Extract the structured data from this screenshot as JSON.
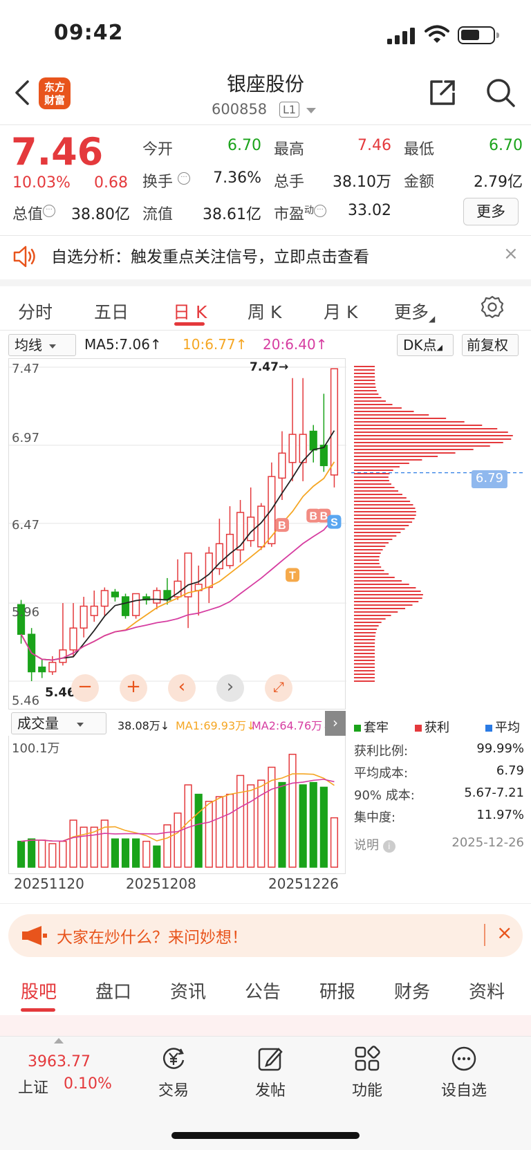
{
  "status_bar": {
    "time": "09:42"
  },
  "header": {
    "logo_text_1": "东方",
    "logo_text_2": "财富",
    "name": "银座股份",
    "code": "600858",
    "level": "L1"
  },
  "quote": {
    "price": "7.46",
    "change_pct": "10.03%",
    "change": "0.68",
    "fields": [
      {
        "label": "今开",
        "value": "6.70",
        "color": "#1aa31a"
      },
      {
        "label": "最高",
        "value": "7.46",
        "color": "#e4393c"
      },
      {
        "label": "最低",
        "value": "6.70",
        "color": "#1aa31a"
      },
      {
        "label": "换手",
        "value": "7.36%",
        "color": "#222222"
      },
      {
        "label": "总手",
        "value": "38.10万",
        "color": "#222222"
      },
      {
        "label": "金额",
        "value": "2.79亿",
        "color": "#222222"
      },
      {
        "label": "总值",
        "value": "38.80亿",
        "color": "#222222"
      },
      {
        "label": "流值",
        "value": "38.61亿",
        "color": "#222222"
      },
      {
        "label": "市盈",
        "label_sup": "动",
        "value": "33.02",
        "color": "#222222"
      }
    ],
    "more_label": "更多"
  },
  "analysis_bar": {
    "text": "自选分析：触发重点关注信号，立即点击查看",
    "close": "×"
  },
  "chart_tabs": {
    "items": [
      "分时",
      "五日",
      "日 K",
      "周 K",
      "月 K",
      "更多"
    ],
    "active_index": 2
  },
  "ma_bar": {
    "select": "均线",
    "ma5": "MA5:7.06↑",
    "ma10": "10:6.77↑",
    "ma20": "20:6.40↑",
    "dk": "DK点",
    "adjust": "前复权",
    "colors": {
      "ma5": "#222222",
      "ma10": "#f5a623",
      "ma20": "#d63ca0"
    }
  },
  "kline": {
    "price_labels": [
      "7.47",
      "6.97",
      "6.47",
      "5.96",
      "5.46"
    ],
    "high_annot": "7.47→",
    "low_annot": "5.46",
    "avg_cost_label": "6.79",
    "signals": {
      "buy": "B",
      "sell": "S",
      "t": "T"
    }
  },
  "chart_data": {
    "type": "candlestick",
    "ylim": [
      5.46,
      7.47
    ],
    "candles": [
      {
        "o": 5.95,
        "c": 5.76,
        "h": 5.98,
        "l": 5.7
      },
      {
        "o": 5.76,
        "c": 5.52,
        "h": 5.8,
        "l": 5.46
      },
      {
        "o": 5.55,
        "c": 5.52,
        "h": 5.6,
        "l": 5.48
      },
      {
        "o": 5.52,
        "c": 5.58,
        "h": 5.62,
        "l": 5.5
      },
      {
        "o": 5.58,
        "c": 5.66,
        "h": 5.96,
        "l": 5.56
      },
      {
        "o": 5.66,
        "c": 5.8,
        "h": 5.96,
        "l": 5.62
      },
      {
        "o": 5.8,
        "c": 5.94,
        "h": 6.0,
        "l": 5.74
      },
      {
        "o": 5.88,
        "c": 5.94,
        "h": 6.04,
        "l": 5.84
      },
      {
        "o": 5.94,
        "c": 6.04,
        "h": 6.06,
        "l": 5.88
      },
      {
        "o": 6.03,
        "c": 6.0,
        "h": 6.05,
        "l": 5.97
      },
      {
        "o": 6.0,
        "c": 5.88,
        "h": 6.02,
        "l": 5.86
      },
      {
        "o": 5.88,
        "c": 6.02,
        "h": 6.02,
        "l": 5.86
      },
      {
        "o": 6.0,
        "c": 5.98,
        "h": 6.02,
        "l": 5.95
      },
      {
        "o": 5.96,
        "c": 6.04,
        "h": 6.06,
        "l": 5.92
      },
      {
        "o": 6.04,
        "c": 5.98,
        "h": 6.12,
        "l": 5.95
      },
      {
        "o": 6.0,
        "c": 6.1,
        "h": 6.24,
        "l": 5.98
      },
      {
        "o": 6.0,
        "c": 6.28,
        "h": 6.28,
        "l": 5.8
      },
      {
        "o": 6.04,
        "c": 6.08,
        "h": 6.2,
        "l": 5.88
      },
      {
        "o": 6.06,
        "c": 6.28,
        "h": 6.32,
        "l": 5.96
      },
      {
        "o": 6.18,
        "c": 6.34,
        "h": 6.5,
        "l": 6.14
      },
      {
        "o": 6.2,
        "c": 6.4,
        "h": 6.58,
        "l": 6.18
      },
      {
        "o": 6.3,
        "c": 6.54,
        "h": 6.62,
        "l": 6.22
      },
      {
        "o": 6.36,
        "c": 6.51,
        "h": 6.7,
        "l": 6.32
      },
      {
        "o": 6.32,
        "c": 6.58,
        "h": 6.6,
        "l": 6.3
      },
      {
        "o": 6.34,
        "c": 6.77,
        "h": 6.86,
        "l": 6.32
      },
      {
        "o": 6.76,
        "c": 6.92,
        "h": 7.06,
        "l": 6.62
      },
      {
        "o": 6.86,
        "c": 7.04,
        "h": 7.4,
        "l": 6.74
      },
      {
        "o": 6.86,
        "c": 7.04,
        "h": 7.4,
        "l": 6.74
      },
      {
        "o": 7.06,
        "c": 6.94,
        "h": 7.1,
        "l": 6.86
      },
      {
        "o": 6.97,
        "c": 6.84,
        "h": 7.3,
        "l": 6.8
      },
      {
        "o": 6.78,
        "c": 7.46,
        "h": 7.46,
        "l": 6.7
      }
    ],
    "volume": {
      "label": "成交量",
      "max_label": "100.1万",
      "vol": "38.08万↓",
      "ma1": "MA1:69.93万↓",
      "ma2": "MA2:64.76万↓",
      "bars": [
        0.22,
        0.24,
        0.23,
        0.2,
        0.22,
        0.4,
        0.34,
        0.34,
        0.4,
        0.24,
        0.24,
        0.24,
        0.22,
        0.18,
        0.36,
        0.46,
        0.7,
        0.62,
        0.56,
        0.6,
        0.62,
        0.78,
        0.7,
        0.74,
        0.85,
        0.72,
        0.96,
        0.7,
        0.72,
        0.68,
        0.42
      ],
      "up": [
        false,
        false,
        true,
        true,
        true,
        true,
        true,
        true,
        true,
        false,
        false,
        false,
        true,
        false,
        true,
        true,
        true,
        false,
        true,
        true,
        true,
        true,
        true,
        true,
        true,
        false,
        true,
        false,
        false,
        false,
        true
      ]
    },
    "dates": [
      "20251120",
      "20251208",
      "20251226"
    ]
  },
  "volume_profile": {
    "legend": [
      {
        "label": "套牢",
        "color": "#1aa31a"
      },
      {
        "label": "获利",
        "color": "#e4393c"
      },
      {
        "label": "平均",
        "color": "#2b7be4"
      }
    ],
    "stats": [
      {
        "label": "获利比例:",
        "value": "99.99%"
      },
      {
        "label": "平均成本:",
        "value": "6.79"
      },
      {
        "label": "90% 成本:",
        "value": "5.67-7.21"
      },
      {
        "label": "集中度:",
        "value": "11.97%"
      }
    ],
    "explain": "说明",
    "date": "2025-12-26"
  },
  "banner": {
    "text": "大家在炒什么？来问妙想！",
    "close": "×"
  },
  "bottom_tabs": {
    "items": [
      "股吧",
      "盘口",
      "资讯",
      "公告",
      "研报",
      "财务",
      "资料"
    ],
    "active_index": 0
  },
  "bottom_bar": {
    "index_value": "3963.77",
    "index_name": "上证",
    "index_pct": "0.10%",
    "items": [
      {
        "label": "交易",
        "icon": "yen-cycle-icon"
      },
      {
        "label": "发帖",
        "icon": "compose-icon"
      },
      {
        "label": "功能",
        "icon": "grid-icon"
      },
      {
        "label": "设自选",
        "icon": "more-circle-icon"
      }
    ]
  }
}
